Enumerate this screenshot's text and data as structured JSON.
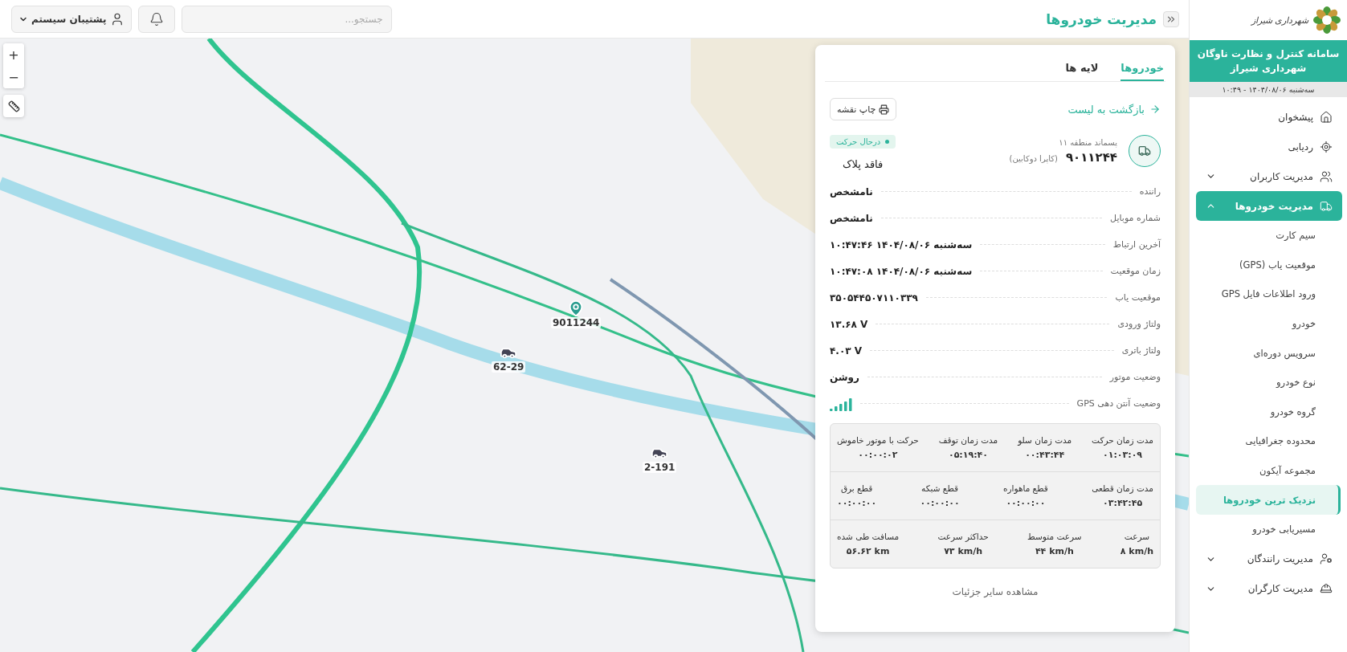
{
  "header": {
    "title": "مدیریت خودروها",
    "search": {
      "placeholder": "جستجو..."
    },
    "user": {
      "name": "پشتیبان سیستم"
    }
  },
  "map": {
    "zoom_in": "+",
    "zoom_out": "−",
    "markers": [
      {
        "kind": "pin",
        "label": "9011244"
      },
      {
        "kind": "car",
        "label": "62-29"
      },
      {
        "kind": "car",
        "label": "2-191"
      }
    ]
  },
  "panel": {
    "tabs": [
      {
        "label": "خودروها",
        "selected": true
      },
      {
        "label": "لایه ها",
        "selected": false
      }
    ],
    "back_link": "بازگشت به لیست",
    "print_button": "چاپ نقشه",
    "vehicle": {
      "group": "پسماند منطقه ۱۱",
      "code": "۹۰۱۱۲۴۴",
      "model": "(کاپرا دوکابین)",
      "status": "درحال حرکت",
      "plate": "فاقد پلاک"
    },
    "details": [
      {
        "kind": "text",
        "label": "راننده",
        "value": "نامشخص"
      },
      {
        "kind": "text",
        "label": "شماره موبایل",
        "value": "نامشخص"
      },
      {
        "kind": "text",
        "label": "آخرین ارتباط",
        "value": "سه‌شنبه ۱۴۰۴/۰۸/۰۶ ۱۰:۴۷:۴۶"
      },
      {
        "kind": "text",
        "label": "زمان موقعیت",
        "value": "سه‌شنبه ۱۴۰۴/۰۸/۰۶ ۱۰:۴۷:۰۸"
      },
      {
        "kind": "text",
        "label": "موقعیت یاب",
        "value": "۳۵۰۵۴۴۵۰۷۱۱۰۳۳۹"
      },
      {
        "kind": "text",
        "label": "ولتاژ ورودی",
        "value": "۱۳.۶۸ V"
      },
      {
        "kind": "text",
        "label": "ولتاژ باتری",
        "value": "۴.۰۳ V"
      },
      {
        "kind": "text",
        "label": "وضعیت موتور",
        "value": "روشن"
      },
      {
        "kind": "signal",
        "label": "وضعیت آنتن دهی GPS"
      }
    ],
    "stats": [
      [
        {
          "label": "مدت زمان حرکت",
          "value": "۰۱:۰۳:۰۹"
        },
        {
          "label": "مدت زمان سلو",
          "value": "۰۰:۴۳:۴۴"
        },
        {
          "label": "مدت زمان توقف",
          "value": "۰۵:۱۹:۴۰"
        },
        {
          "label": "حرکت با موتور خاموش",
          "value": "۰۰:۰۰:۰۲"
        }
      ],
      [
        {
          "label": "مدت زمان قطعی",
          "value": "۰۳:۴۲:۴۵"
        },
        {
          "label": "قطع ماهواره",
          "value": "۰۰:۰۰:۰۰"
        },
        {
          "label": "قطع شبکه",
          "value": "۰۰:۰۰:۰۰"
        },
        {
          "label": "قطع برق",
          "value": "۰۰:۰۰:۰۰"
        }
      ],
      [
        {
          "label": "سرعت",
          "value": "۸ km/h"
        },
        {
          "label": "سرعت متوسط",
          "value": "۴۴ km/h"
        },
        {
          "label": "حداکثر سرعت",
          "value": "۷۳ km/h"
        },
        {
          "label": "مسافت طی شده",
          "value": "۵۶.۶۲ km"
        }
      ]
    ],
    "more_link": "مشاهده سایر جزئیات"
  },
  "sidebar": {
    "brand": "شهرداری شیراز",
    "system_title": "سامانه کنترل و نظارت ناوگان شهرداری شیراز",
    "date": "سه‌شنبه ۱۴۰۴/۰۸/۰۶ - ۱۰:۴۹",
    "items": [
      {
        "kind": "link",
        "label": "پیشخوان",
        "selected": false
      },
      {
        "kind": "link",
        "label": "ردیابی",
        "selected": false
      },
      {
        "kind": "group",
        "label": "مدیریت کاربران",
        "selected": false,
        "expanded": false
      },
      {
        "kind": "group",
        "label": "مدیریت خودروها",
        "selected": true,
        "expanded": true,
        "children": [
          {
            "label": "سیم کارت",
            "selected": false
          },
          {
            "label": "موقعیت یاب (GPS)",
            "selected": false
          },
          {
            "label": "ورود اطلاعات فایل GPS",
            "selected": false
          },
          {
            "label": "خودرو",
            "selected": false
          },
          {
            "label": "سرویس دوره‌ای",
            "selected": false
          },
          {
            "label": "نوع خودرو",
            "selected": false
          },
          {
            "label": "گروه خودرو",
            "selected": false
          },
          {
            "label": "محدوده جغرافیایی",
            "selected": false
          },
          {
            "label": "مجموعه آیکون",
            "selected": false
          },
          {
            "label": "نزدیک ترین خودروها",
            "selected": true
          },
          {
            "label": "مسیریابی خودرو",
            "selected": false
          }
        ]
      },
      {
        "kind": "group",
        "label": "مدیریت رانندگان",
        "selected": false,
        "expanded": false
      },
      {
        "kind": "group",
        "label": "مدیریت کارگران",
        "selected": false,
        "expanded": false
      }
    ]
  }
}
